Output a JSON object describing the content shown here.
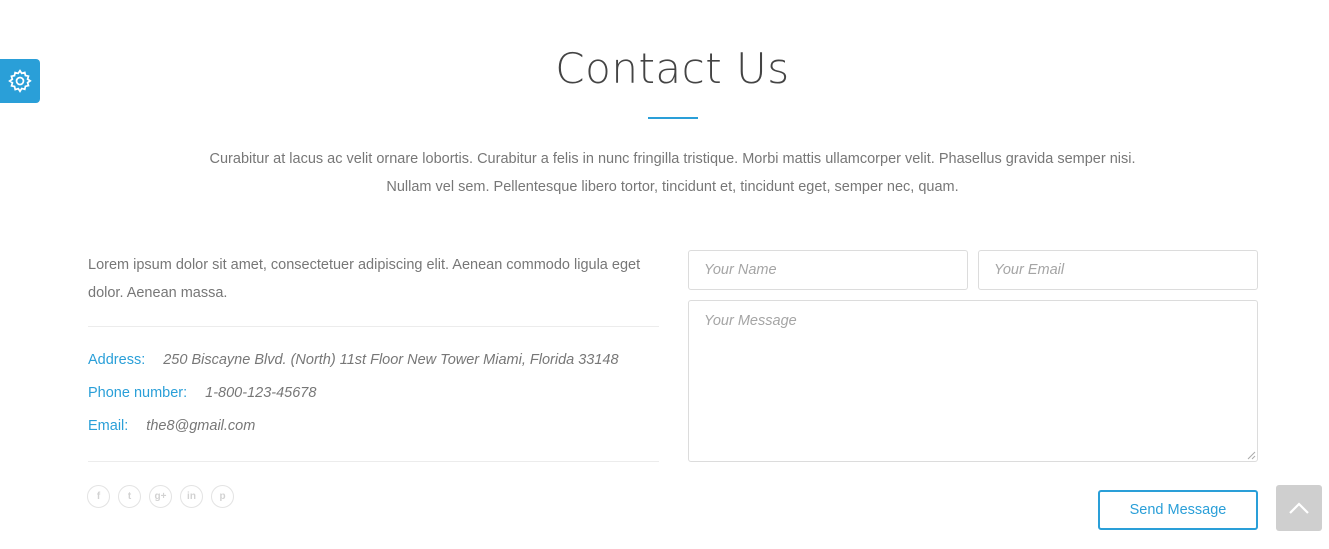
{
  "settings": {
    "icon": "gear-icon",
    "color": "#2a9fd8"
  },
  "section": {
    "title": "Contact Us",
    "intro": "Curabitur at lacus ac velit ornare lobortis. Curabitur a felis in nunc fringilla tristique. Morbi mattis ullamcorper velit. Phasellus gravida semper nisi. Nullam vel sem. Pellentesque libero tortor, tincidunt et, tincidunt eget, semper nec, quam."
  },
  "contact_info": {
    "lead": "Lorem ipsum dolor sit amet, consectetuer adipiscing elit. Aenean commodo ligula eget dolor. Aenean massa.",
    "address_label": "Address:",
    "address_value": "250 Biscayne Blvd. (North) 11st Floor New Tower Miami, Florida 33148",
    "phone_label": "Phone number:",
    "phone_value": "1-800-123-45678",
    "email_label": "Email:",
    "email_value": "the8@gmail.com"
  },
  "socials": [
    {
      "icon": "facebook-icon",
      "glyph": "f"
    },
    {
      "icon": "twitter-icon",
      "glyph": "t"
    },
    {
      "icon": "google-plus-icon",
      "glyph": "g+"
    },
    {
      "icon": "linkedin-icon",
      "glyph": "in"
    },
    {
      "icon": "pinterest-icon",
      "glyph": "p"
    }
  ],
  "form": {
    "name_placeholder": "Your Name",
    "email_placeholder": "Your Email",
    "message_placeholder": "Your Message",
    "submit_label": "Send Message"
  },
  "back_to_top": {
    "icon": "chevron-up-icon"
  },
  "colors": {
    "accent": "#2a9fd8",
    "text": "#777777",
    "heading": "#444444",
    "border": "#dcdcdc"
  }
}
